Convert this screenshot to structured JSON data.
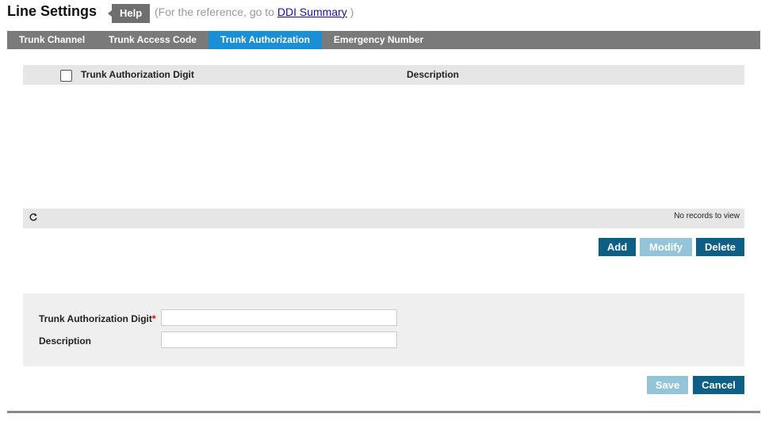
{
  "page": {
    "title": "Line Settings"
  },
  "help": {
    "label": "Help"
  },
  "reference": {
    "prefix": "(For the reference, go to ",
    "link": "DDI Summary",
    "suffix": " )"
  },
  "tabs": [
    {
      "label": "Trunk Channel",
      "active": false
    },
    {
      "label": "Trunk Access Code",
      "active": false
    },
    {
      "label": "Trunk Authorization",
      "active": true
    },
    {
      "label": "Emergency Number",
      "active": false
    }
  ],
  "grid": {
    "columns": [
      "Trunk Authorization Digit",
      "Description"
    ],
    "rows": [],
    "empty_text": "No records to view"
  },
  "actions": {
    "add": "Add",
    "modify": "Modify",
    "delete": "Delete"
  },
  "form": {
    "digit_label": "Trunk Authorization Digit",
    "required_mark": "*",
    "digit_value": "",
    "description_label": "Description",
    "description_value": ""
  },
  "footer": {
    "save": "Save",
    "cancel": "Cancel"
  },
  "colors": {
    "tab_active": "#1a8fd4",
    "tabbar": "#7a7a7a",
    "button_primary": "#0d5f86",
    "button_disabled": "#93c4d9"
  },
  "icons": {
    "refresh": "refresh-icon"
  }
}
